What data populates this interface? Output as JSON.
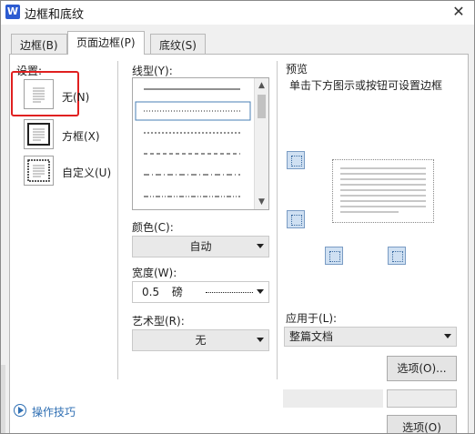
{
  "window": {
    "title": "边框和底纹",
    "app_icon": "W",
    "close_icon": "close-icon"
  },
  "tabs": [
    {
      "label": "边框(B)"
    },
    {
      "label": "页面边框(P)",
      "active": true
    },
    {
      "label": "底纹(S)"
    }
  ],
  "settings": {
    "heading": "设置:",
    "options": [
      {
        "label": "无(N)",
        "icon": "none-border-icon",
        "highlighted": true
      },
      {
        "label": "方框(X)",
        "icon": "box-border-icon"
      },
      {
        "label": "自定义(U)",
        "icon": "custom-border-icon"
      }
    ],
    "highlight_color": "#e02020"
  },
  "line_style": {
    "label": "线型(Y):"
  },
  "color": {
    "label": "颜色(C):",
    "value": "自动"
  },
  "width": {
    "label": "宽度(W):",
    "value": "0.5",
    "unit": "磅"
  },
  "art": {
    "label": "艺术型(R):",
    "value": "无"
  },
  "preview": {
    "heading": "预览",
    "hint": "单击下方图示或按钮可设置边框"
  },
  "apply_to": {
    "label": "应用于(L):",
    "value": "整篇文档"
  },
  "buttons": {
    "options": "选项(O)...",
    "options2": "选项(O)"
  },
  "tips": {
    "label": "操作技巧"
  },
  "colors": {
    "accent": "#2c5bd1",
    "tips_link": "#2f6fb3"
  }
}
